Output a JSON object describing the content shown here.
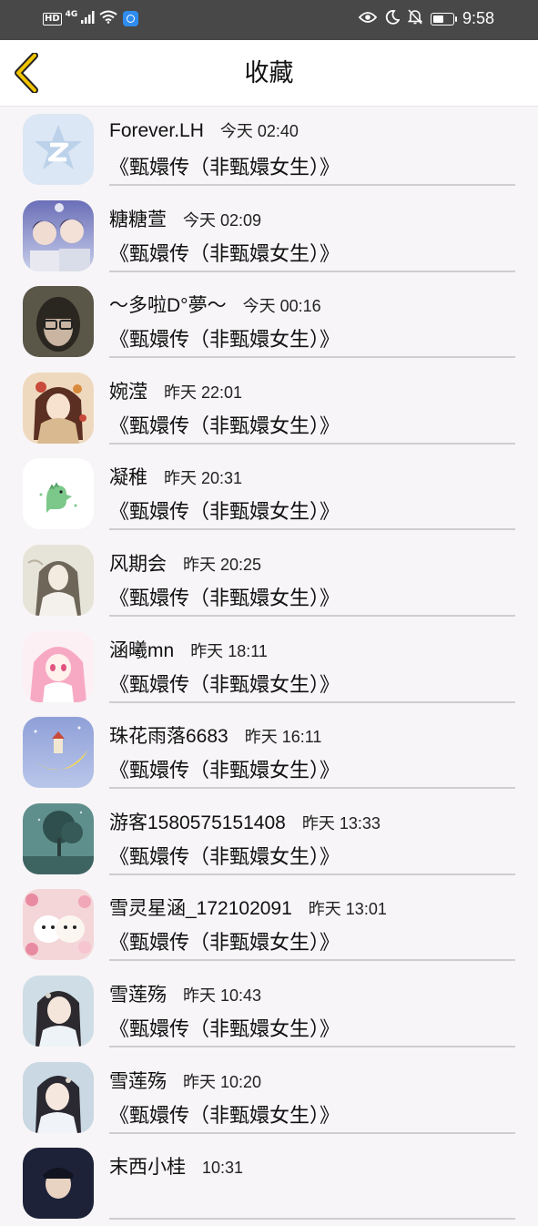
{
  "status_bar": {
    "hd": "HD",
    "network": "4G",
    "time": "9:58",
    "icons": [
      "signal-icon",
      "wifi-icon",
      "app-notification-icon",
      "eye-icon",
      "moon-icon",
      "bell-off-icon",
      "battery-icon"
    ]
  },
  "header": {
    "title": "收藏",
    "back_icon": "chevron-left-icon",
    "accent": "#f2c400"
  },
  "favorites": [
    {
      "name": "Forever.LH",
      "time": "今天 02:40",
      "book": "《甄嬛传（非甄嬛女生）》",
      "avatar": "qzone-logo"
    },
    {
      "name": "糖糖萱",
      "time": "今天 02:09",
      "book": "《甄嬛传（非甄嬛女生）》",
      "avatar": "two-boys-photo"
    },
    {
      "name": "～多啦D°夢～",
      "time": "今天 00:16",
      "book": "《甄嬛传（非甄嬛女生）》",
      "avatar": "girl-with-glasses-photo"
    },
    {
      "name": "婉滢",
      "time": "昨天 22:01",
      "book": "《甄嬛传（非甄嬛女生）》",
      "avatar": "anime-girl-illustration"
    },
    {
      "name": "凝稚",
      "time": "昨天 20:31",
      "book": "《甄嬛传（非甄嬛女生）》",
      "avatar": "green-dinosaur-sticker"
    },
    {
      "name": "风期会",
      "time": "昨天 20:25",
      "book": "《甄嬛传（非甄嬛女生）》",
      "avatar": "ancient-style-girl-illustration"
    },
    {
      "name": "涵曦mn",
      "time": "昨天 18:11",
      "book": "《甄嬛传（非甄嬛女生）》",
      "avatar": "pink-anime-girl-illustration"
    },
    {
      "name": "珠花雨落6683",
      "time": "昨天 16:11",
      "book": "《甄嬛传（非甄嬛女生）》",
      "avatar": "moon-boat-illustration"
    },
    {
      "name": "游客1580575151408",
      "time": "昨天 13:33",
      "book": "《甄嬛传（非甄嬛女生）》",
      "avatar": "teal-tree-scene"
    },
    {
      "name": "雪灵星涵_172102091",
      "time": "昨天 13:01",
      "book": "《甄嬛传（非甄嬛女生）》",
      "avatar": "white-puppies-flowers"
    },
    {
      "name": "雪莲殇",
      "time": "昨天 10:43",
      "book": "《甄嬛传（非甄嬛女生）》",
      "avatar": "costume-girl-photo"
    },
    {
      "name": "雪莲殇",
      "time": "昨天 10:20",
      "book": "《甄嬛传（非甄嬛女生）》",
      "avatar": "costume-girl-photo"
    },
    {
      "name": "末西小桂",
      "time": "10:31",
      "book": "",
      "avatar": "dark-hair-portrait"
    }
  ]
}
